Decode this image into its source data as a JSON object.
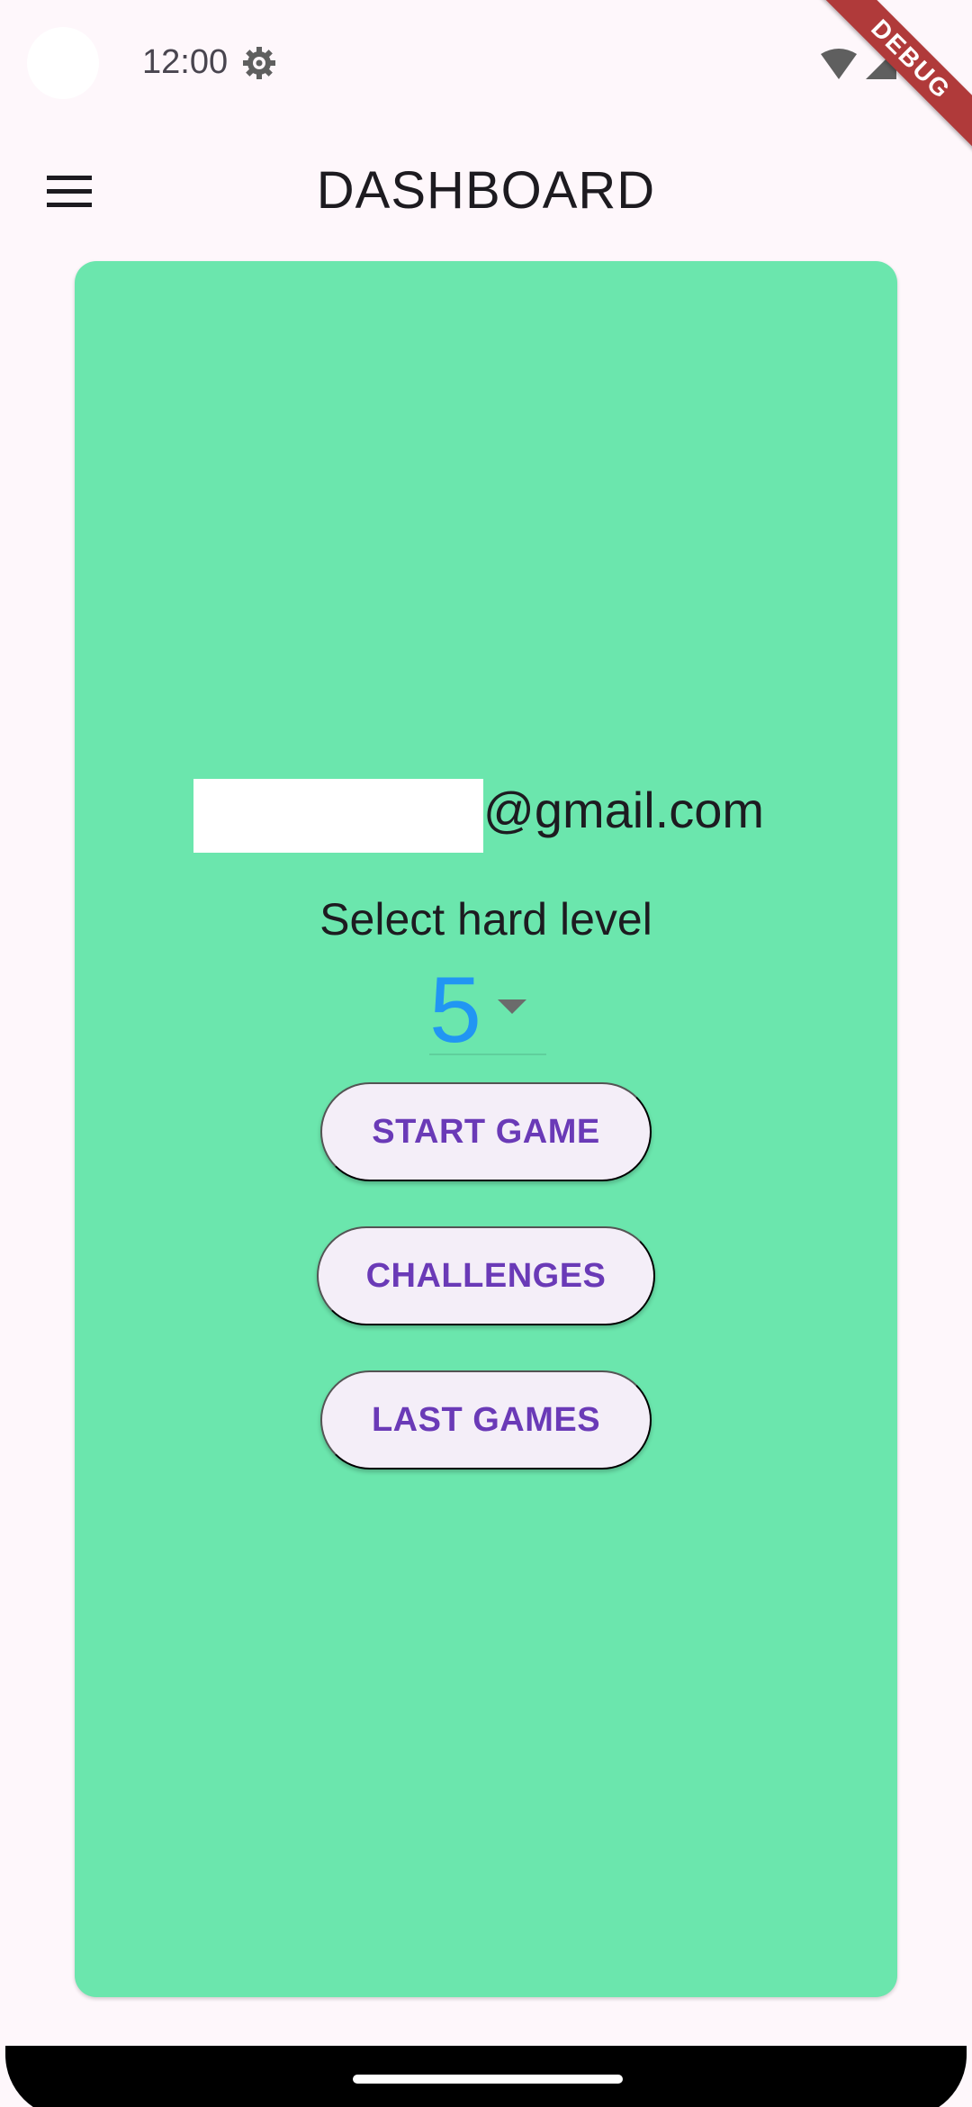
{
  "status_bar": {
    "time": "12:00",
    "icons": [
      "gear-icon",
      "wifi-icon",
      "signal-icon",
      "battery-icon"
    ]
  },
  "debug_banner": "DEBUG",
  "app_bar": {
    "menu_icon": "menu-icon",
    "title": "DASHBOARD"
  },
  "card": {
    "email_domain": "@gmail.com",
    "level_label": "Select hard level",
    "level_value": "5",
    "buttons": {
      "start": "START GAME",
      "challenges": "CHALLENGES",
      "last": "LAST GAMES"
    }
  },
  "colors": {
    "background": "#fef7fb",
    "card": "#6be6ad",
    "button_bg": "#f4eef8",
    "button_text": "#6a3ab7",
    "level_value": "#2196f3"
  }
}
